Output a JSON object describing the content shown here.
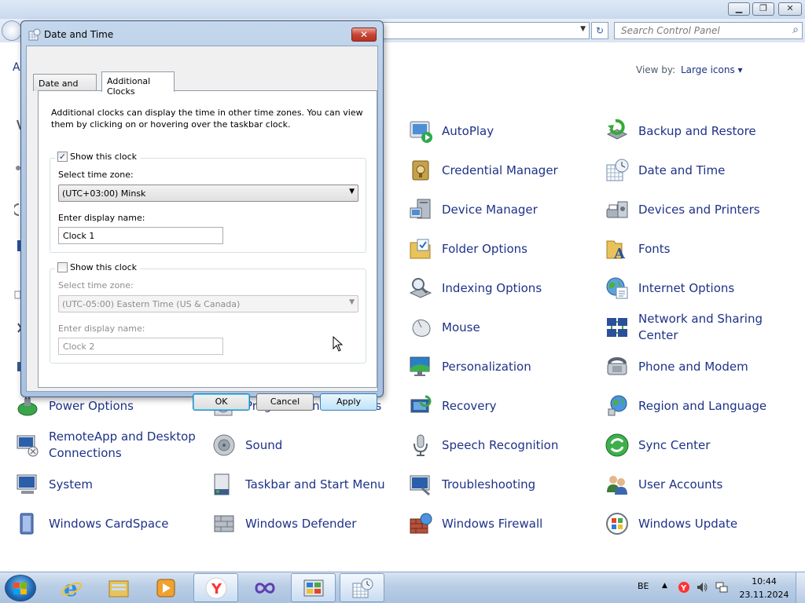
{
  "control_panel": {
    "search_placeholder": "Search Control Panel",
    "heading_stub": "A",
    "view_by_label": "View by:",
    "view_by_value": "Large icons ▾",
    "items": [
      {
        "label": "AutoPlay",
        "icon": "autoplay-icon"
      },
      {
        "label": "Backup and Restore",
        "icon": "backup-icon"
      },
      {
        "label": "Credential Manager",
        "icon": "credential-icon"
      },
      {
        "label": "Date and Time",
        "icon": "date-time-icon"
      },
      {
        "label": "Device Manager",
        "icon": "device-manager-icon"
      },
      {
        "label": "Devices and Printers",
        "icon": "printer-icon"
      },
      {
        "label": "Folder Options",
        "icon": "folder-icon"
      },
      {
        "label": "Fonts",
        "icon": "fonts-icon"
      },
      {
        "label": "Indexing Options",
        "icon": "indexing-icon"
      },
      {
        "label": "Internet Options",
        "icon": "internet-icon"
      },
      {
        "label": "Mouse",
        "icon": "mouse-icon"
      },
      {
        "label": "Network and Sharing Center",
        "icon": "network-icon"
      },
      {
        "label": "Personalization",
        "icon": "personalization-icon"
      },
      {
        "label": "Phone and Modem",
        "icon": "phone-icon"
      },
      {
        "label": "Power Options",
        "icon": "power-icon"
      },
      {
        "label": "Programs and Features",
        "icon": "programs-icon"
      },
      {
        "label": "Recovery",
        "icon": "recovery-icon"
      },
      {
        "label": "Region and Language",
        "icon": "globe-icon"
      },
      {
        "label": "RemoteApp and Desktop Connections",
        "icon": "remoteapp-icon"
      },
      {
        "label": "Sound",
        "icon": "speaker-icon"
      },
      {
        "label": "Speech Recognition",
        "icon": "microphone-icon"
      },
      {
        "label": "Sync Center",
        "icon": "sync-icon"
      },
      {
        "label": "System",
        "icon": "system-icon"
      },
      {
        "label": "Taskbar and Start Menu",
        "icon": "taskbar-icon"
      },
      {
        "label": "Troubleshooting",
        "icon": "troubleshooting-icon"
      },
      {
        "label": "User Accounts",
        "icon": "users-icon"
      },
      {
        "label": "Windows CardSpace",
        "icon": "cardspace-icon"
      },
      {
        "label": "Windows Defender",
        "icon": "defender-icon"
      },
      {
        "label": "Windows Firewall",
        "icon": "firewall-icon"
      },
      {
        "label": "Windows Update",
        "icon": "update-icon"
      }
    ]
  },
  "dialog": {
    "title": "Date and Time",
    "tabs": [
      "Date and Time",
      "Additional Clocks"
    ],
    "intro": "Additional clocks can display the time in other time zones. You can view them by clicking on or hovering over the taskbar clock.",
    "clock1": {
      "show_label": "Show this clock",
      "checked": true,
      "timezone_label": "Select time zone:",
      "timezone_value": "(UTC+03:00) Minsk",
      "name_label": "Enter display name:",
      "name_value": "Clock 1"
    },
    "clock2": {
      "show_label": "Show this clock",
      "checked": false,
      "timezone_label": "Select time zone:",
      "timezone_value": "(UTC-05:00) Eastern Time (US & Canada)",
      "name_label": "Enter display name:",
      "name_value": "Clock 2"
    },
    "buttons": {
      "ok": "OK",
      "cancel": "Cancel",
      "apply": "Apply"
    }
  },
  "taskbar": {
    "language": "BE",
    "time": "10:44",
    "date": "23.11.2024",
    "pinned": [
      "internet-explorer-icon",
      "explorer-icon",
      "media-player-icon",
      "yandex-browser-icon",
      "visual-studio-icon",
      "control-panel-icon",
      "date-time-icon"
    ]
  },
  "colors": {
    "link": "#1e3287",
    "title_bar": "#b3c9e4",
    "close_button": "#c74535"
  }
}
